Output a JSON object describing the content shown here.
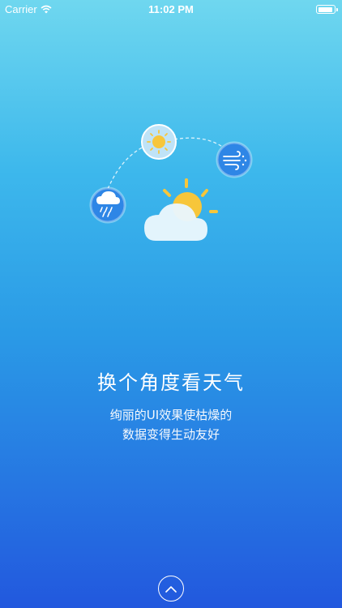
{
  "status_bar": {
    "carrier": "Carrier",
    "time": "11:02 PM",
    "battery_level": 0.95
  },
  "illustration": {
    "icons": [
      "rain-icon",
      "sun-icon",
      "wind-icon",
      "sun-cloud-icon"
    ],
    "colors": {
      "icon_circle": "#2e86e6",
      "sun": "#f7c63a",
      "cloud": "#e9f6fc"
    }
  },
  "headline": "换个角度看天气",
  "subtitle": {
    "line1": "绚丽的UI效果使枯燥的",
    "line2": "数据变得生动友好"
  },
  "up_button": {
    "icon": "chevron-up-icon"
  }
}
